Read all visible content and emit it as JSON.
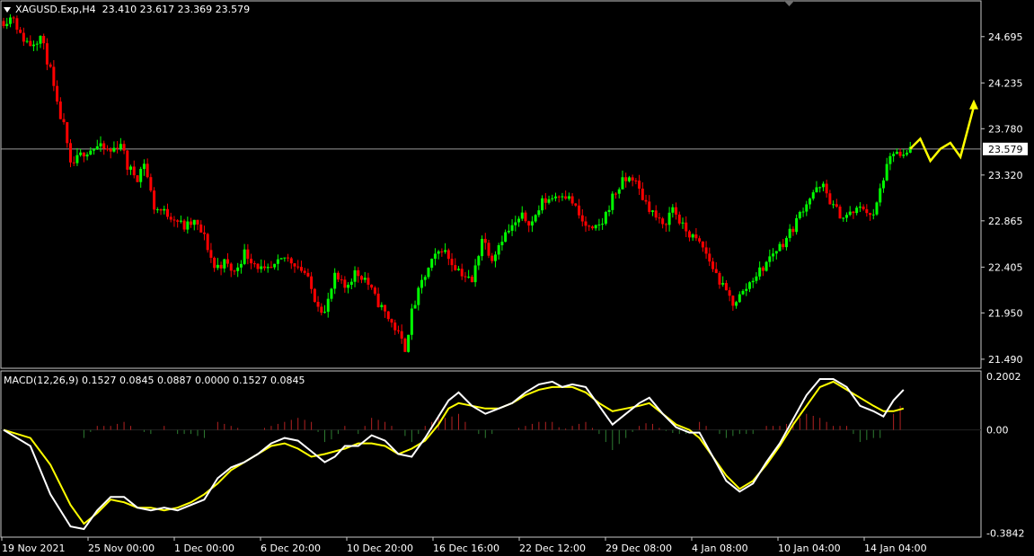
{
  "main_header": {
    "symbol": "XAGUSD.Exp,H4",
    "open": "23.410",
    "high": "23.617",
    "low": "23.369",
    "close": "23.579"
  },
  "macd_header": {
    "text": "MACD(12,26,9) 0.1527 0.0845 0.0887 0.0000 0.1527 0.0845"
  },
  "chart_data": [
    {
      "type": "candlestick",
      "symbol": "XAGUSD.Exp",
      "timeframe": "H4",
      "y_ticks": [
        "24.695",
        "24.235",
        "23.780",
        "23.320",
        "22.865",
        "22.405",
        "21.950",
        "21.490"
      ],
      "ylim": [
        21.4,
        25.05
      ],
      "current_price": 23.579,
      "current_price_label": "23.579",
      "x_ticks": [
        "19 Nov 2021",
        "25 Nov 00:00",
        "1 Dec 00:00",
        "6 Dec 20:00",
        "10 Dec 20:00",
        "16 Dec 16:00",
        "22 Dec 12:00",
        "29 Dec 08:00",
        "4 Jan 08:00",
        "10 Jan 04:00",
        "14 Jan 04:00"
      ],
      "price_path": [
        [
          0,
          24.85
        ],
        [
          3,
          24.9
        ],
        [
          5,
          24.7
        ],
        [
          8,
          24.62
        ],
        [
          11,
          24.7
        ],
        [
          14,
          24.35
        ],
        [
          16,
          24.0
        ],
        [
          18,
          23.8
        ],
        [
          20,
          23.4
        ],
        [
          24,
          23.55
        ],
        [
          28,
          23.6
        ],
        [
          32,
          23.55
        ],
        [
          35,
          23.65
        ],
        [
          37,
          23.4
        ],
        [
          40,
          23.3
        ],
        [
          42,
          23.45
        ],
        [
          45,
          23.0
        ],
        [
          48,
          22.95
        ],
        [
          51,
          22.9
        ],
        [
          54,
          22.8
        ],
        [
          57,
          22.85
        ],
        [
          60,
          22.7
        ],
        [
          63,
          22.4
        ],
        [
          66,
          22.45
        ],
        [
          69,
          22.35
        ],
        [
          72,
          22.55
        ],
        [
          75,
          22.45
        ],
        [
          78,
          22.35
        ],
        [
          81,
          22.4
        ],
        [
          84,
          22.5
        ],
        [
          87,
          22.45
        ],
        [
          90,
          22.35
        ],
        [
          93,
          22.1
        ],
        [
          96,
          21.95
        ],
        [
          99,
          22.3
        ],
        [
          102,
          22.2
        ],
        [
          105,
          22.35
        ],
        [
          108,
          22.3
        ],
        [
          111,
          22.1
        ],
        [
          114,
          21.95
        ],
        [
          117,
          21.8
        ],
        [
          120,
          21.6
        ],
        [
          122,
          21.95
        ],
        [
          125,
          22.25
        ],
        [
          128,
          22.45
        ],
        [
          131,
          22.6
        ],
        [
          134,
          22.45
        ],
        [
          137,
          22.35
        ],
        [
          140,
          22.25
        ],
        [
          143,
          22.7
        ],
        [
          146,
          22.5
        ],
        [
          149,
          22.7
        ],
        [
          152,
          22.8
        ],
        [
          155,
          22.9
        ],
        [
          158,
          22.85
        ],
        [
          161,
          23.05
        ],
        [
          164,
          23.1
        ],
        [
          167,
          23.15
        ],
        [
          170,
          23.05
        ],
        [
          173,
          22.85
        ],
        [
          176,
          22.75
        ],
        [
          179,
          22.85
        ],
        [
          182,
          23.1
        ],
        [
          185,
          23.25
        ],
        [
          188,
          23.3
        ],
        [
          191,
          23.1
        ],
        [
          194,
          22.95
        ],
        [
          197,
          22.8
        ],
        [
          200,
          23.0
        ],
        [
          203,
          22.8
        ],
        [
          206,
          22.7
        ],
        [
          209,
          22.6
        ],
        [
          212,
          22.4
        ],
        [
          215,
          22.2
        ],
        [
          218,
          22.05
        ],
        [
          221,
          22.15
        ],
        [
          224,
          22.3
        ],
        [
          227,
          22.4
        ],
        [
          230,
          22.55
        ],
        [
          233,
          22.65
        ],
        [
          236,
          22.8
        ],
        [
          239,
          23.0
        ],
        [
          242,
          23.15
        ],
        [
          245,
          23.2
        ],
        [
          248,
          23.0
        ],
        [
          251,
          22.9
        ],
        [
          254,
          22.95
        ],
        [
          257,
          23.0
        ],
        [
          260,
          22.9
        ],
        [
          263,
          23.3
        ],
        [
          266,
          23.55
        ],
        [
          269,
          23.48
        ],
        [
          271,
          23.58
        ]
      ],
      "forecast_path": [
        [
          271,
          23.58
        ],
        [
          274,
          23.68
        ],
        [
          277,
          23.46
        ],
        [
          280,
          23.58
        ],
        [
          283,
          23.64
        ],
        [
          286,
          23.5
        ],
        [
          290,
          24.0
        ]
      ],
      "bullish_color": "#00ff00",
      "bearish_color": "#ff0000",
      "forecast_color": "#ffff00"
    },
    {
      "type": "macd",
      "params": "12,26,9",
      "y_ticks": [
        "0.2002",
        "0.00",
        "-0.3842"
      ],
      "ylim": [
        -0.4,
        0.22
      ],
      "macd_line": [
        [
          0,
          0.0
        ],
        [
          8,
          -0.06
        ],
        [
          14,
          -0.24
        ],
        [
          20,
          -0.36
        ],
        [
          24,
          -0.37
        ],
        [
          28,
          -0.3
        ],
        [
          32,
          -0.25
        ],
        [
          36,
          -0.25
        ],
        [
          40,
          -0.29
        ],
        [
          44,
          -0.3
        ],
        [
          48,
          -0.29
        ],
        [
          52,
          -0.3
        ],
        [
          56,
          -0.28
        ],
        [
          60,
          -0.26
        ],
        [
          64,
          -0.18
        ],
        [
          68,
          -0.14
        ],
        [
          72,
          -0.12
        ],
        [
          76,
          -0.09
        ],
        [
          80,
          -0.05
        ],
        [
          84,
          -0.03
        ],
        [
          88,
          -0.04
        ],
        [
          92,
          -0.08
        ],
        [
          96,
          -0.12
        ],
        [
          99,
          -0.1
        ],
        [
          102,
          -0.06
        ],
        [
          106,
          -0.06
        ],
        [
          110,
          -0.02
        ],
        [
          114,
          -0.04
        ],
        [
          118,
          -0.09
        ],
        [
          122,
          -0.1
        ],
        [
          126,
          -0.03
        ],
        [
          130,
          0.05
        ],
        [
          133,
          0.11
        ],
        [
          136,
          0.14
        ],
        [
          140,
          0.09
        ],
        [
          144,
          0.06
        ],
        [
          148,
          0.08
        ],
        [
          152,
          0.1
        ],
        [
          156,
          0.14
        ],
        [
          160,
          0.17
        ],
        [
          164,
          0.18
        ],
        [
          167,
          0.16
        ],
        [
          170,
          0.17
        ],
        [
          174,
          0.16
        ],
        [
          178,
          0.09
        ],
        [
          182,
          0.02
        ],
        [
          186,
          0.06
        ],
        [
          190,
          0.1
        ],
        [
          193,
          0.12
        ],
        [
          197,
          0.06
        ],
        [
          201,
          0.01
        ],
        [
          205,
          -0.01
        ],
        [
          208,
          -0.01
        ],
        [
          212,
          -0.1
        ],
        [
          216,
          -0.19
        ],
        [
          220,
          -0.23
        ],
        [
          224,
          -0.2
        ],
        [
          228,
          -0.12
        ],
        [
          232,
          -0.05
        ],
        [
          236,
          0.04
        ],
        [
          240,
          0.13
        ],
        [
          244,
          0.19
        ],
        [
          248,
          0.19
        ],
        [
          252,
          0.16
        ],
        [
          256,
          0.09
        ],
        [
          260,
          0.07
        ],
        [
          263,
          0.05
        ],
        [
          266,
          0.11
        ],
        [
          269,
          0.15
        ]
      ],
      "signal_line": [
        [
          0,
          0.0
        ],
        [
          8,
          -0.03
        ],
        [
          14,
          -0.13
        ],
        [
          20,
          -0.28
        ],
        [
          24,
          -0.35
        ],
        [
          28,
          -0.31
        ],
        [
          32,
          -0.26
        ],
        [
          36,
          -0.27
        ],
        [
          40,
          -0.29
        ],
        [
          44,
          -0.29
        ],
        [
          48,
          -0.3
        ],
        [
          52,
          -0.29
        ],
        [
          56,
          -0.27
        ],
        [
          60,
          -0.24
        ],
        [
          64,
          -0.2
        ],
        [
          68,
          -0.15
        ],
        [
          72,
          -0.12
        ],
        [
          76,
          -0.09
        ],
        [
          80,
          -0.06
        ],
        [
          84,
          -0.05
        ],
        [
          88,
          -0.07
        ],
        [
          92,
          -0.1
        ],
        [
          96,
          -0.09
        ],
        [
          99,
          -0.08
        ],
        [
          102,
          -0.07
        ],
        [
          106,
          -0.05
        ],
        [
          110,
          -0.05
        ],
        [
          114,
          -0.06
        ],
        [
          118,
          -0.09
        ],
        [
          122,
          -0.07
        ],
        [
          126,
          -0.04
        ],
        [
          130,
          0.02
        ],
        [
          133,
          0.08
        ],
        [
          136,
          0.1
        ],
        [
          140,
          0.09
        ],
        [
          144,
          0.08
        ],
        [
          148,
          0.08
        ],
        [
          152,
          0.1
        ],
        [
          156,
          0.13
        ],
        [
          160,
          0.15
        ],
        [
          164,
          0.16
        ],
        [
          167,
          0.16
        ],
        [
          170,
          0.16
        ],
        [
          174,
          0.14
        ],
        [
          178,
          0.1
        ],
        [
          182,
          0.07
        ],
        [
          186,
          0.08
        ],
        [
          190,
          0.09
        ],
        [
          193,
          0.1
        ],
        [
          197,
          0.06
        ],
        [
          201,
          0.02
        ],
        [
          205,
          0.0
        ],
        [
          208,
          -0.03
        ],
        [
          212,
          -0.1
        ],
        [
          216,
          -0.17
        ],
        [
          220,
          -0.22
        ],
        [
          224,
          -0.19
        ],
        [
          228,
          -0.13
        ],
        [
          232,
          -0.06
        ],
        [
          236,
          0.02
        ],
        [
          240,
          0.09
        ],
        [
          244,
          0.16
        ],
        [
          248,
          0.18
        ],
        [
          252,
          0.15
        ],
        [
          256,
          0.12
        ],
        [
          260,
          0.09
        ],
        [
          263,
          0.07
        ],
        [
          266,
          0.07
        ],
        [
          269,
          0.08
        ]
      ],
      "macd_color": "#ffffff",
      "signal_color": "#ffff00",
      "hist_positive_color": "#b22222",
      "hist_negative_color": "#2e7d32"
    }
  ]
}
